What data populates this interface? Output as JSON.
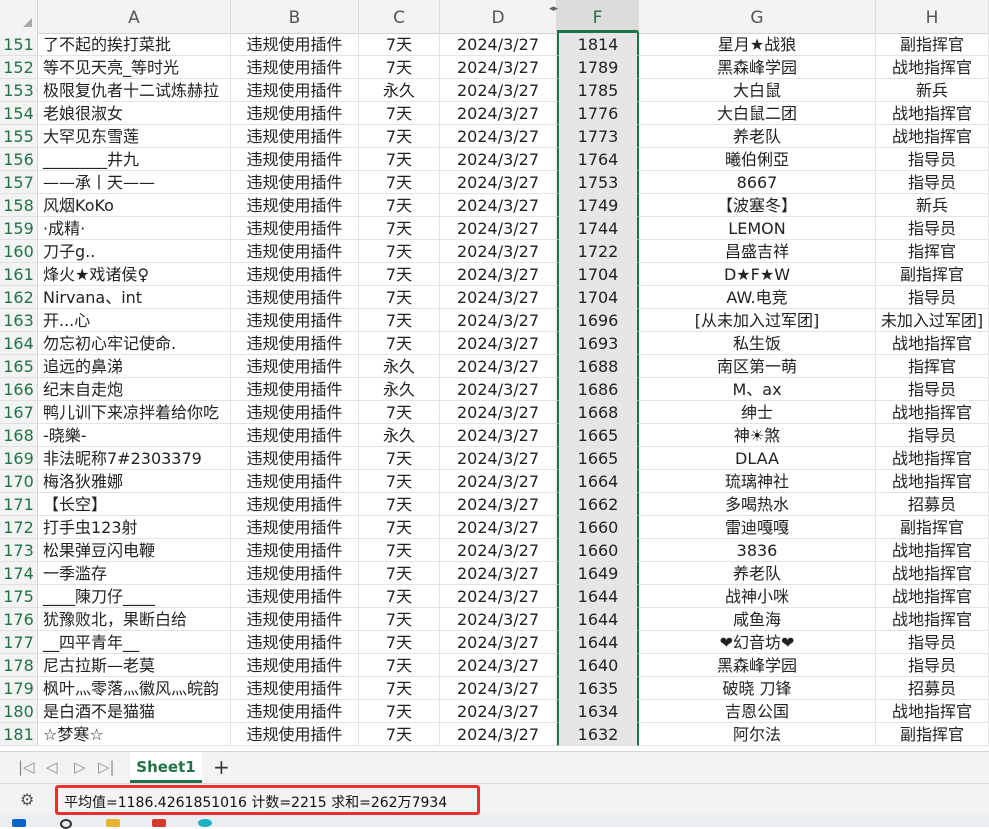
{
  "columns": [
    "A",
    "B",
    "C",
    "D",
    "F",
    "G",
    "H"
  ],
  "selected_column": "F",
  "rows": [
    {
      "n": "151",
      "a": "了不起的挨打菜批",
      "b": "违规使用插件",
      "c": "7天",
      "d": "2024/3/27",
      "f": "1814",
      "g": "星月★战狼",
      "h": "副指挥官"
    },
    {
      "n": "152",
      "a": "等不见天亮_等时光",
      "b": "违规使用插件",
      "c": "7天",
      "d": "2024/3/27",
      "f": "1789",
      "g": "黑森峰学园",
      "h": "战地指挥官"
    },
    {
      "n": "153",
      "a": "极限复仇者十二试炼赫拉",
      "b": "违规使用插件",
      "c": "永久",
      "d": "2024/3/27",
      "f": "1785",
      "g": "大白鼠",
      "h": "新兵"
    },
    {
      "n": "154",
      "a": "老娘很淑女",
      "b": "违规使用插件",
      "c": "7天",
      "d": "2024/3/27",
      "f": "1776",
      "g": "大白鼠二团",
      "h": "战地指挥官"
    },
    {
      "n": "155",
      "a": "大罕见东雪莲",
      "b": "违规使用插件",
      "c": "7天",
      "d": "2024/3/27",
      "f": "1773",
      "g": "养老队",
      "h": "战地指挥官"
    },
    {
      "n": "156",
      "a": "________井九",
      "b": "违规使用插件",
      "c": "7天",
      "d": "2024/3/27",
      "f": "1764",
      "g": "曦伯俐亞",
      "h": "指导员"
    },
    {
      "n": "157",
      "a": "——承丨天——",
      "b": "违规使用插件",
      "c": "7天",
      "d": "2024/3/27",
      "f": "1753",
      "g": "8667",
      "h": "指导员"
    },
    {
      "n": "158",
      "a": "风烟KoKo",
      "b": "违规使用插件",
      "c": "7天",
      "d": "2024/3/27",
      "f": "1749",
      "g": "【波塞冬】",
      "h": "新兵"
    },
    {
      "n": "159",
      "a": "·成精·",
      "b": "违规使用插件",
      "c": "7天",
      "d": "2024/3/27",
      "f": "1744",
      "g": "LEMON",
      "h": "指导员"
    },
    {
      "n": "160",
      "a": "刀子g..",
      "b": "违规使用插件",
      "c": "7天",
      "d": "2024/3/27",
      "f": "1722",
      "g": "昌盛吉祥",
      "h": "指挥官"
    },
    {
      "n": "161",
      "a": "烽火★戏诸侯♀",
      "b": "违规使用插件",
      "c": "7天",
      "d": "2024/3/27",
      "f": "1704",
      "g": "D★F★W",
      "h": "副指挥官"
    },
    {
      "n": "162",
      "a": "Nirvana、int",
      "b": "违规使用插件",
      "c": "7天",
      "d": "2024/3/27",
      "f": "1704",
      "g": "AW.电竞",
      "h": "指导员"
    },
    {
      "n": "163",
      "a": "开...心",
      "b": "违规使用插件",
      "c": "7天",
      "d": "2024/3/27",
      "f": "1696",
      "g": "[从未加入过军团]",
      "h": "未加入过军团]"
    },
    {
      "n": "164",
      "a": "勿忘初心牢记使命.",
      "b": "违规使用插件",
      "c": "7天",
      "d": "2024/3/27",
      "f": "1693",
      "g": "私生饭",
      "h": "战地指挥官"
    },
    {
      "n": "165",
      "a": "追远的鼻涕",
      "b": "违规使用插件",
      "c": "永久",
      "d": "2024/3/27",
      "f": "1688",
      "g": "南区第一萌",
      "h": "指挥官"
    },
    {
      "n": "166",
      "a": "纪末自走炮",
      "b": "违规使用插件",
      "c": "永久",
      "d": "2024/3/27",
      "f": "1686",
      "g": "M、ax",
      "h": "指导员"
    },
    {
      "n": "167",
      "a": "鸭儿训下来凉拌着给你吃",
      "b": "违规使用插件",
      "c": "7天",
      "d": "2024/3/27",
      "f": "1668",
      "g": "绅士",
      "h": "战地指挥官"
    },
    {
      "n": "168",
      "a": "-晓樂-",
      "b": "违规使用插件",
      "c": "永久",
      "d": "2024/3/27",
      "f": "1665",
      "g": "神☀煞",
      "h": "指导员"
    },
    {
      "n": "169",
      "a": "非法昵称7#2303379",
      "b": "违规使用插件",
      "c": "7天",
      "d": "2024/3/27",
      "f": "1665",
      "g": "DLAA",
      "h": "战地指挥官"
    },
    {
      "n": "170",
      "a": "梅洛狄雅娜",
      "b": "违规使用插件",
      "c": "7天",
      "d": "2024/3/27",
      "f": "1664",
      "g": "琉璃神社",
      "h": "战地指挥官"
    },
    {
      "n": "171",
      "a": "【长空】",
      "b": "违规使用插件",
      "c": "7天",
      "d": "2024/3/27",
      "f": "1662",
      "g": "多喝热水",
      "h": "招募员"
    },
    {
      "n": "172",
      "a": "打手虫123射",
      "b": "违规使用插件",
      "c": "7天",
      "d": "2024/3/27",
      "f": "1660",
      "g": "雷迪嘎嘎",
      "h": "副指挥官"
    },
    {
      "n": "173",
      "a": "松果弹豆闪电鞭",
      "b": "违规使用插件",
      "c": "7天",
      "d": "2024/3/27",
      "f": "1660",
      "g": "3836",
      "h": "战地指挥官"
    },
    {
      "n": "174",
      "a": "一季滥存",
      "b": "违规使用插件",
      "c": "7天",
      "d": "2024/3/27",
      "f": "1649",
      "g": "养老队",
      "h": "战地指挥官"
    },
    {
      "n": "175",
      "a": "____陳刀仔____",
      "b": "违规使用插件",
      "c": "7天",
      "d": "2024/3/27",
      "f": "1644",
      "g": "战神小咪",
      "h": "战地指挥官"
    },
    {
      "n": "176",
      "a": "犹豫败北，果断白给",
      "b": "违规使用插件",
      "c": "7天",
      "d": "2024/3/27",
      "f": "1644",
      "g": "咸鱼海",
      "h": "战地指挥官"
    },
    {
      "n": "177",
      "a": "__四平青年__",
      "b": "违规使用插件",
      "c": "7天",
      "d": "2024/3/27",
      "f": "1644",
      "g": "❤幻音坊❤",
      "h": "指导员"
    },
    {
      "n": "178",
      "a": "尼古拉斯—老莫",
      "b": "违规使用插件",
      "c": "7天",
      "d": "2024/3/27",
      "f": "1640",
      "g": "黑森峰学园",
      "h": "指导员"
    },
    {
      "n": "179",
      "a": "枫叶灬零落灬徽风灬皖韵",
      "b": "违规使用插件",
      "c": "7天",
      "d": "2024/3/27",
      "f": "1635",
      "g": "破晓 刀锋",
      "h": "招募员"
    },
    {
      "n": "180",
      "a": "是白酒不是猫猫",
      "b": "违规使用插件",
      "c": "7天",
      "d": "2024/3/27",
      "f": "1634",
      "g": "吉恩公国",
      "h": "战地指挥官"
    },
    {
      "n": "181",
      "a": "☆梦寒☆",
      "b": "违规使用插件",
      "c": "7天",
      "d": "2024/3/27",
      "f": "1632",
      "g": "阿尔法",
      "h": "副指挥官"
    }
  ],
  "sheet_tab": "Sheet1",
  "add_tab": "+",
  "nav": {
    "first": "|◁",
    "prev": "◁",
    "next": "▷",
    "last": "▷|"
  },
  "status_text": "平均值=1186.4261851016  计数=2215  求和=262万7934",
  "accent_color": "#217346",
  "highlight_color": "#e8312d"
}
